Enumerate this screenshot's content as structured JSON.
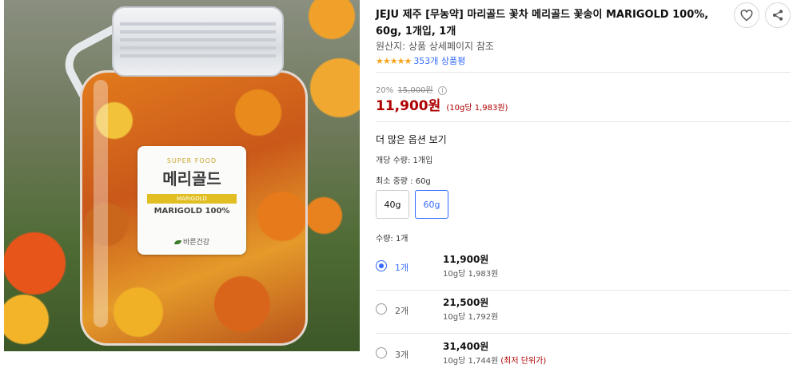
{
  "product_image": {
    "label_super": "SUPER FOOD",
    "label_korean": "메리골드",
    "label_band": "MARIGOLD",
    "label_english": "MARIGOLD 100%",
    "label_brand": "바른건강"
  },
  "title": "JEJU 제주 [무농약] 마리골드 꽃차 메리골드 꽃송이 MARIGOLD 100%, 60g, 1개입, 1개",
  "actions": {
    "wishlist_icon": "heart-icon",
    "share_icon": "share-icon"
  },
  "origin": "원산지: 상품 상세페이지 참조",
  "rating": {
    "stars": "★★★★★",
    "score": 4.5,
    "reviews": "353개 상품평"
  },
  "pricing": {
    "discount": "20%",
    "original": "15,000원",
    "price": "11,900원",
    "unit_price": "(10g당 1,983원)"
  },
  "options": {
    "more_label": "더 많은 옵션 보기",
    "unit_count": "개당 수량: 1개입",
    "min_weight": "최소 중량 : 60g",
    "weights": [
      "40g",
      "60g"
    ],
    "selected_weight": "60g",
    "quantity_label": "수량: 1개"
  },
  "quantities": [
    {
      "count": "1개",
      "price": "11,900원",
      "unit": "10g당 1,983원",
      "note": "",
      "selected": true
    },
    {
      "count": "2개",
      "price": "21,500원",
      "unit": "10g당 1,792원",
      "note": "",
      "selected": false
    },
    {
      "count": "3개",
      "price": "31,400원",
      "unit": "10g당 1,744원",
      "note": "(최저 단위가)",
      "selected": false
    }
  ]
}
